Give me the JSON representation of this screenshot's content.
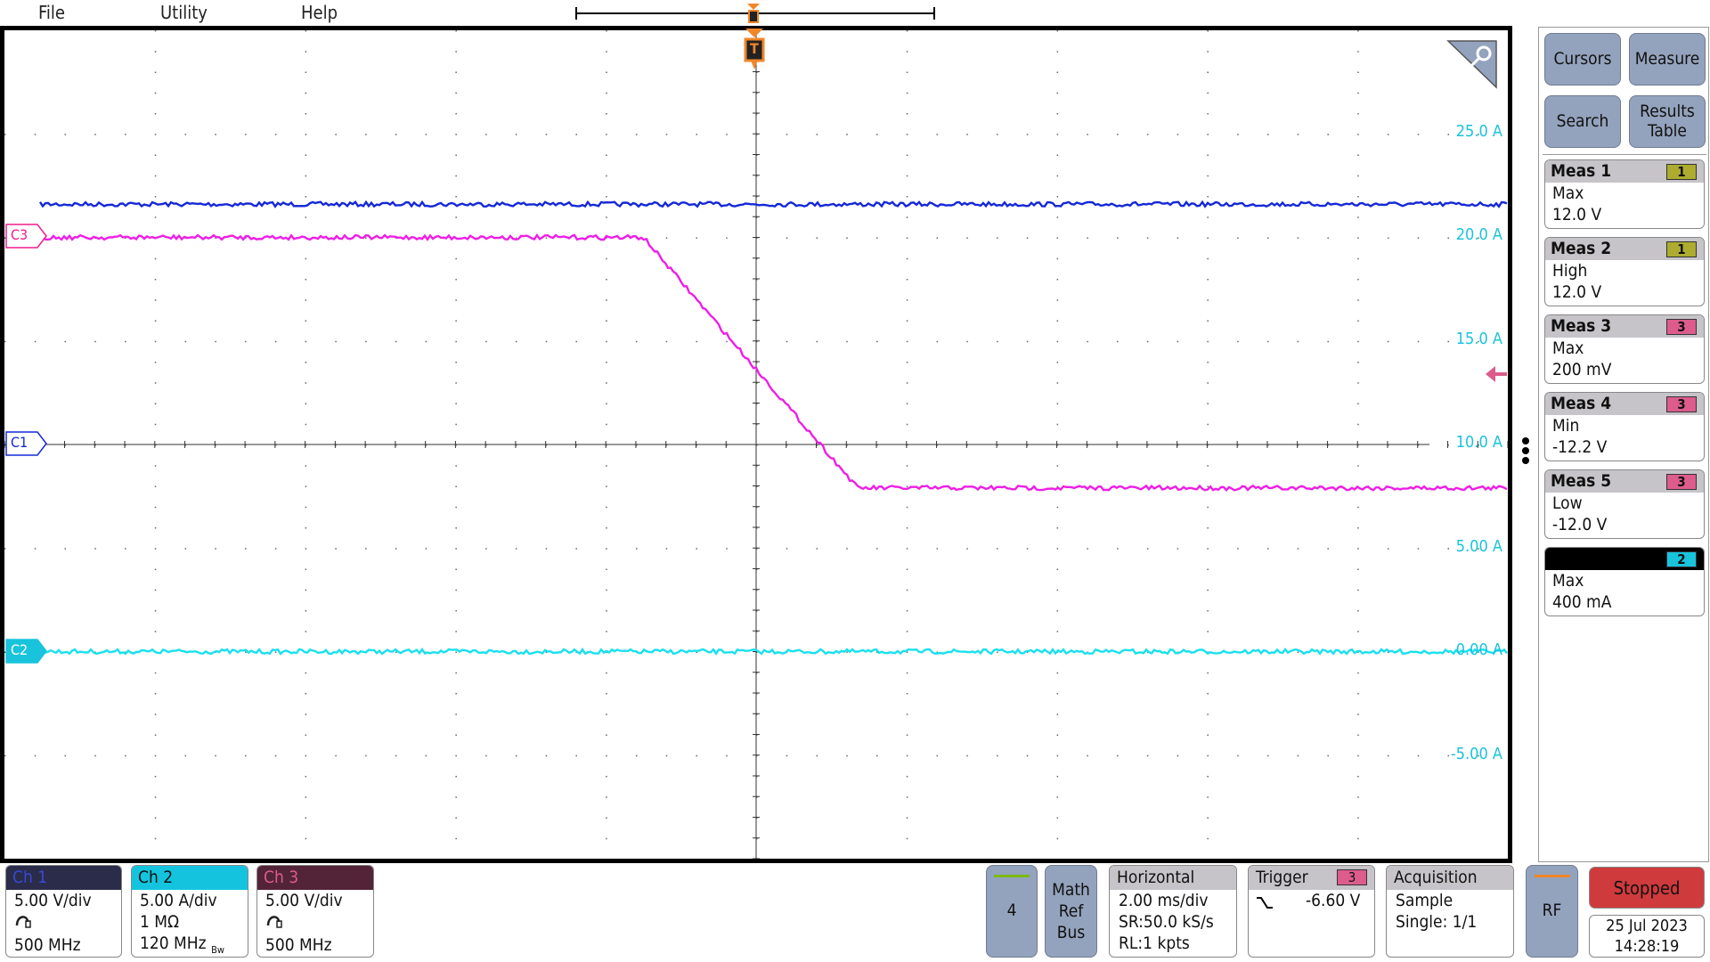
{
  "menu": {
    "file": "File",
    "utility": "Utility",
    "help": "Help"
  },
  "trigger_marker": "T",
  "scale_labels": [
    "25.0 A",
    "20.0 A",
    "15.0 A",
    "10.0 A",
    "5.00 A",
    "0.00 A",
    "-5.00 A"
  ],
  "channel_markers": {
    "c1": "C1",
    "c2": "C2",
    "c3": "C3"
  },
  "colors": {
    "ch1": "#1428d8",
    "ch2": "#19e0ee",
    "ch3": "#ee1ee6",
    "ch3_ui": "#dd5c8c",
    "trigger": "#f0862a",
    "math": "#7dba10"
  },
  "waveforms": {
    "time_per_div_ms": 2,
    "ch1": {
      "volts_per_div": 5,
      "level_V": 11.6
    },
    "ch2": {
      "amps_per_div": 5,
      "level_A": 0
    },
    "ch3": {
      "volts_per_div": 5,
      "points_ms_V": [
        [
          -10,
          0
        ],
        [
          -1.5,
          0
        ],
        [
          1.35,
          -12.1
        ],
        [
          10,
          -12.1
        ]
      ]
    }
  },
  "right_panel": {
    "buttons": [
      "Cursors",
      "Measure",
      "Search",
      "Results Table"
    ],
    "measurements": [
      {
        "title": "Meas 1",
        "source": "1",
        "type": "Max",
        "value": "12.0 V"
      },
      {
        "title": "Meas 2",
        "source": "1",
        "type": "High",
        "value": "12.0 V"
      },
      {
        "title": "Meas 3",
        "source": "3",
        "type": "Max",
        "value": "200 mV"
      },
      {
        "title": "Meas 4",
        "source": "3",
        "type": "Min",
        "value": "-12.2 V"
      },
      {
        "title": "Meas 5",
        "source": "3",
        "type": "Low",
        "value": "-12.0 V"
      },
      {
        "title": "",
        "source": "2",
        "type": "Max",
        "value": "400 mA"
      }
    ]
  },
  "channels": [
    {
      "name": "Ch 1",
      "scale": "5.00 V/div",
      "line2": "",
      "bw": "500 MHz"
    },
    {
      "name": "Ch 2",
      "scale": "5.00 A/div",
      "line2": "1 MΩ",
      "bw": "120 MHz",
      "bw_flag": "Bw"
    },
    {
      "name": "Ch 3",
      "scale": "5.00 V/div",
      "line2": "",
      "bw": "500 MHz"
    }
  ],
  "bottom": {
    "ch4": "4",
    "math_ref_bus": [
      "Math",
      "Ref",
      "Bus"
    ],
    "horizontal": {
      "title": "Horizontal",
      "scale": "2.00 ms/div",
      "sr": "SR:50.0 kS/s",
      "rl": "RL:1 kpts"
    },
    "trigger": {
      "title": "Trigger",
      "source": "3",
      "level": "-6.60 V"
    },
    "acquisition": {
      "title": "Acquisition",
      "mode": "Sample",
      "count": "Single: 1/1"
    },
    "rf": "RF",
    "status": "Stopped",
    "date": "25 Jul 2023",
    "time": "14:28:19"
  }
}
